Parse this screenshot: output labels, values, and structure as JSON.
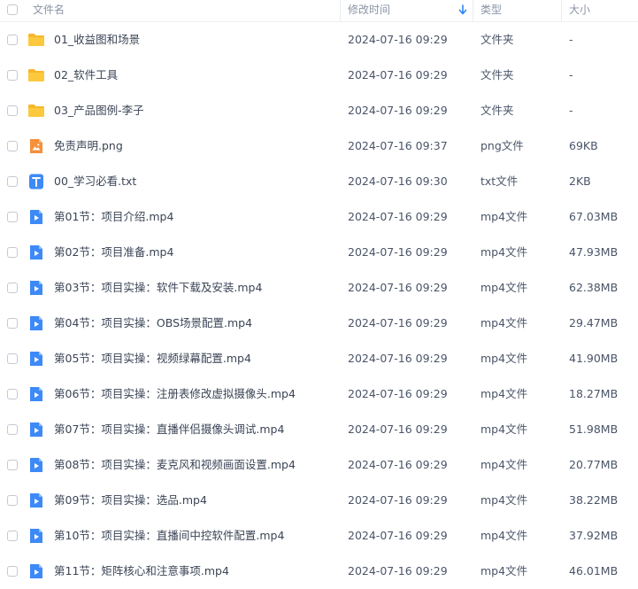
{
  "header": {
    "name_label": "文件名",
    "time_label": "修改时间",
    "type_label": "类型",
    "size_label": "大小",
    "sort_icon": "arrow-down-icon"
  },
  "icons": {
    "folder": "folder-icon",
    "image": "image-file-icon",
    "text": "text-file-icon",
    "video": "video-file-icon"
  },
  "files": [
    {
      "icon": "folder",
      "name": "01_收益图和场景",
      "time": "2024-07-16 09:29",
      "type": "文件夹",
      "size": "-"
    },
    {
      "icon": "folder",
      "name": "02_软件工具",
      "time": "2024-07-16 09:29",
      "type": "文件夹",
      "size": "-"
    },
    {
      "icon": "folder",
      "name": "03_产品图例-李子",
      "time": "2024-07-16 09:29",
      "type": "文件夹",
      "size": "-"
    },
    {
      "icon": "image",
      "name": "免责声明.png",
      "time": "2024-07-16 09:37",
      "type": "png文件",
      "size": "69KB"
    },
    {
      "icon": "text",
      "name": "00_学习必看.txt",
      "time": "2024-07-16 09:30",
      "type": "txt文件",
      "size": "2KB"
    },
    {
      "icon": "video",
      "name": "第01节：项目介绍.mp4",
      "time": "2024-07-16 09:29",
      "type": "mp4文件",
      "size": "67.03MB"
    },
    {
      "icon": "video",
      "name": "第02节：项目准备.mp4",
      "time": "2024-07-16 09:29",
      "type": "mp4文件",
      "size": "47.93MB"
    },
    {
      "icon": "video",
      "name": "第03节：项目实操：软件下载及安装.mp4",
      "time": "2024-07-16 09:29",
      "type": "mp4文件",
      "size": "62.38MB"
    },
    {
      "icon": "video",
      "name": "第04节：项目实操：OBS场景配置.mp4",
      "time": "2024-07-16 09:29",
      "type": "mp4文件",
      "size": "29.47MB"
    },
    {
      "icon": "video",
      "name": "第05节：项目实操：视频绿幕配置.mp4",
      "time": "2024-07-16 09:29",
      "type": "mp4文件",
      "size": "41.90MB"
    },
    {
      "icon": "video",
      "name": "第06节：项目实操：注册表修改虚拟摄像头.mp4",
      "time": "2024-07-16 09:29",
      "type": "mp4文件",
      "size": "18.27MB"
    },
    {
      "icon": "video",
      "name": "第07节：项目实操：直播伴侣摄像头调试.mp4",
      "time": "2024-07-16 09:29",
      "type": "mp4文件",
      "size": "51.98MB"
    },
    {
      "icon": "video",
      "name": "第08节：项目实操：麦克风和视频画面设置.mp4",
      "time": "2024-07-16 09:29",
      "type": "mp4文件",
      "size": "20.77MB"
    },
    {
      "icon": "video",
      "name": "第09节：项目实操：选品.mp4",
      "time": "2024-07-16 09:29",
      "type": "mp4文件",
      "size": "38.22MB"
    },
    {
      "icon": "video",
      "name": "第10节：项目实操：直播间中控软件配置.mp4",
      "time": "2024-07-16 09:29",
      "type": "mp4文件",
      "size": "37.92MB"
    },
    {
      "icon": "video",
      "name": "第11节：矩阵核心和注意事项.mp4",
      "time": "2024-07-16 09:29",
      "type": "mp4文件",
      "size": "46.01MB"
    }
  ]
}
